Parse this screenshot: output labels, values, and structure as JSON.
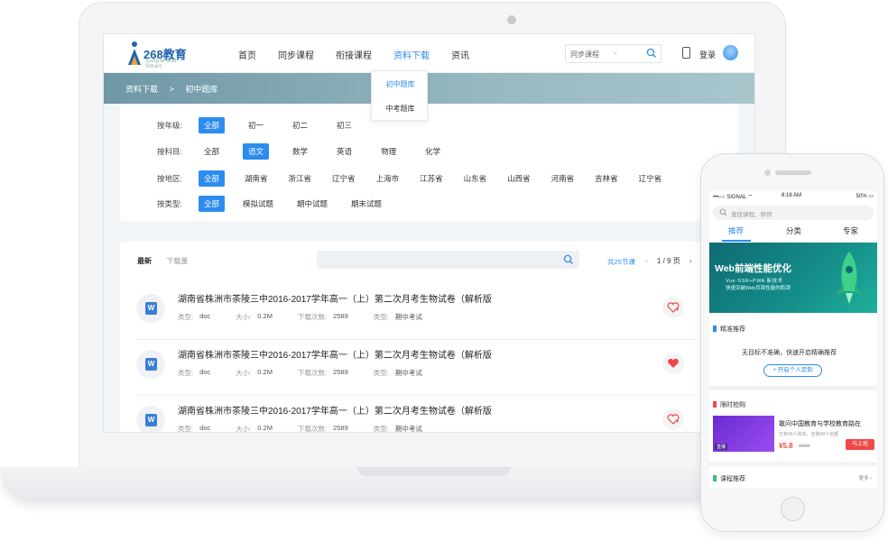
{
  "laptop": {
    "logo": {
      "text": "268教育",
      "sub": "Simple and Smart"
    },
    "nav": [
      {
        "label": "首页"
      },
      {
        "label": "同步课程"
      },
      {
        "label": "衔接课程"
      },
      {
        "label": "资料下载",
        "active": true
      },
      {
        "label": "资讯"
      }
    ],
    "dropdown": [
      "初中题库",
      "中考题库"
    ],
    "search": {
      "category": "同步课程",
      "chevron": "⌄"
    },
    "login_label": "登录",
    "breadcrumb": [
      "资料下载",
      ">",
      "初中题库"
    ],
    "filters": [
      {
        "label": "按年级:",
        "options": [
          "全部",
          "初一",
          "初二",
          "初三"
        ],
        "selected": 0
      },
      {
        "label": "按科目:",
        "options": [
          "全部",
          "语文",
          "数学",
          "英语",
          "物理",
          "化学"
        ],
        "selected": 1
      },
      {
        "label": "按地区:",
        "options": [
          "全部",
          "湖南省",
          "浙江省",
          "辽宁省",
          "上海市",
          "江苏省",
          "山东省",
          "山西省",
          "河南省",
          "吉林省",
          "辽宁省"
        ],
        "selected": 0
      },
      {
        "label": "按类型:",
        "options": [
          "全部",
          "模拟试题",
          "期中试题",
          "期末试题"
        ],
        "selected": 0
      }
    ],
    "list": {
      "tabs": [
        "最新",
        "下载量"
      ],
      "count_text": "共25节课",
      "pager": {
        "prev": "‹",
        "current": "1 / 9 页",
        "next": "›"
      },
      "meta_keys": {
        "type": "类型:",
        "size": "大小:",
        "downloads": "下载次数:",
        "category": "类型:"
      },
      "rows": [
        {
          "icon_letter": "W",
          "title": "湖南省株洲市茶陵三中2016-2017学年高一（上）第二次月考生物试卷（解析版",
          "type": "doc",
          "size": "0.2M",
          "downloads": "2589",
          "category": "期中考试",
          "fav": false
        },
        {
          "icon_letter": "W",
          "title": "湖南省株洲市茶陵三中2016-2017学年高一（上）第二次月考生物试卷（解析版",
          "type": "doc",
          "size": "0.2M",
          "downloads": "2589",
          "category": "期中考试",
          "fav": true
        },
        {
          "icon_letter": "W",
          "title": "湖南省株洲市茶陵三中2016-2017学年高一（上）第二次月考生物试卷（解析版",
          "type": "doc",
          "size": "0.2M",
          "downloads": "2589",
          "category": "期中考试",
          "fav": false
        }
      ]
    }
  },
  "phone": {
    "status": {
      "signal": "•••○○ SIGNAL ⌔",
      "time": "8:16 AM",
      "battery": "50% ▭"
    },
    "search_placeholder": "查找课程、导师",
    "tabs": [
      "推荐",
      "分类",
      "专家"
    ],
    "banner": {
      "title": "Web前端性能优化",
      "sub1": "Vue·SSR+PWA 新技术",
      "sub2": "快速突破Web页面性能的瓶颈"
    },
    "section_precise": {
      "title": "精准推荐",
      "text": "无目标不准确，快速开启精确推荐",
      "button": "+ 开启个人定制"
    },
    "section_flash": {
      "title": "限时抢购",
      "course_title": "敢问中国教育与学校教育路在",
      "course_sub": "已有40人购买，还剩49个名额",
      "price": "¥5.8",
      "old_price": "¥208",
      "buy": "马上抢",
      "img_tag": "直播"
    },
    "section_course": {
      "title": "课程推荐",
      "more": "更多 ›"
    }
  },
  "colors": {
    "accent": "#2d8cf0",
    "danger": "#f04848",
    "banner_teal": "#158f8a"
  }
}
